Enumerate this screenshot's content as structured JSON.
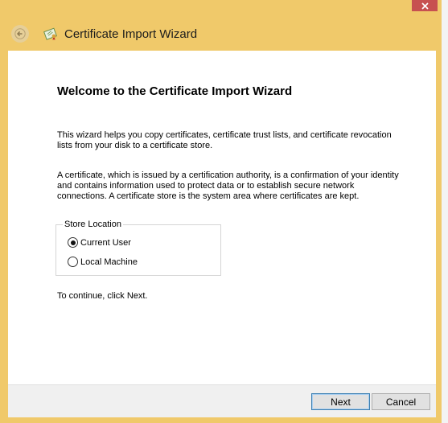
{
  "window": {
    "title": "Certificate Import Wizard"
  },
  "welcome": {
    "heading": "Welcome to the Certificate Import Wizard",
    "para1_line1": "This wizard helps you copy certificates, certificate trust lists, and certificate revocation",
    "para1_line2": "lists from your disk to a certificate store.",
    "para2_line1": "A certificate, which is issued by a certification authority, is a confirmation of your identity",
    "para2_line2": "and contains information used to protect data or to establish secure network",
    "para2_line3": "connections. A certificate store is the system area where certificates are kept."
  },
  "store_location": {
    "label": "Store Location",
    "options": [
      "Current User",
      "Local Machine"
    ],
    "selected": "Current User"
  },
  "continue_text": "To continue, click Next.",
  "buttons": {
    "next": "Next",
    "cancel": "Cancel"
  },
  "icons": {
    "back": "back-arrow-icon",
    "certificate": "certificate-icon",
    "close": "close-icon"
  },
  "colors": {
    "window_frame": "#f0c96a",
    "close_button": "#c75050",
    "content_bg": "#ffffff",
    "footer_bg": "#f0f0f0"
  }
}
